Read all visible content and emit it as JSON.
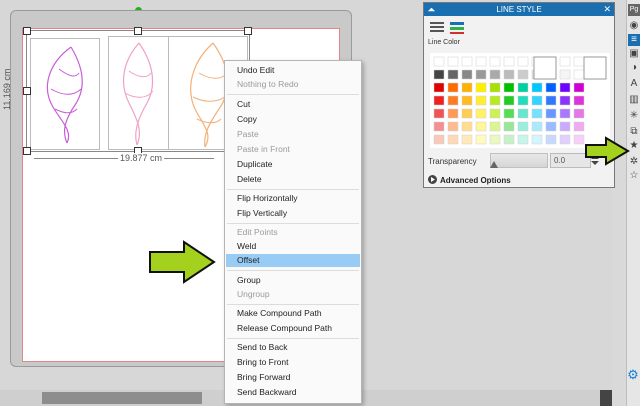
{
  "canvas": {
    "height_label": "11.169 cm",
    "width_label": "19.877 cm"
  },
  "context_menu": {
    "items": [
      {
        "label": "Undo Edit",
        "enabled": true
      },
      {
        "label": "Nothing to Redo",
        "enabled": false
      },
      {
        "label": "Cut",
        "enabled": true
      },
      {
        "label": "Copy",
        "enabled": true
      },
      {
        "label": "Paste",
        "enabled": false
      },
      {
        "label": "Paste in Front",
        "enabled": false
      },
      {
        "label": "Duplicate",
        "enabled": true
      },
      {
        "label": "Delete",
        "enabled": true
      },
      {
        "label": "Flip Horizontally",
        "enabled": true
      },
      {
        "label": "Flip Vertically",
        "enabled": true
      },
      {
        "label": "Edit Points",
        "enabled": false
      },
      {
        "label": "Weld",
        "enabled": true
      },
      {
        "label": "Offset",
        "enabled": true,
        "highlighted": true
      },
      {
        "label": "Group",
        "enabled": true
      },
      {
        "label": "Ungroup",
        "enabled": false
      },
      {
        "label": "Make Compound Path",
        "enabled": true
      },
      {
        "label": "Release Compound Path",
        "enabled": true
      },
      {
        "label": "Send to Back",
        "enabled": true
      },
      {
        "label": "Bring to Front",
        "enabled": true
      },
      {
        "label": "Bring Forward",
        "enabled": true
      },
      {
        "label": "Send Backward",
        "enabled": true
      }
    ]
  },
  "line_style_panel": {
    "title": "LINE STYLE",
    "line_color_label": "Line Color",
    "transparency_label": "Transparency",
    "transparency_value": "0.0",
    "advanced_label": "Advanced Options"
  },
  "colors": {
    "accent": "#1a6fb0",
    "highlight": "#99ccf5",
    "arrow_green": "#a4d11e"
  }
}
